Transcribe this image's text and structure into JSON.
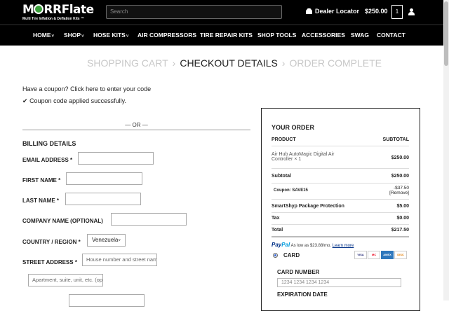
{
  "header": {
    "logo_text_pre": "M",
    "logo_text_post": "RRFlate",
    "logo_tagline": "Multi Tire Inflation & Deflation Kits ™",
    "search_placeholder": "Search",
    "dealer_locator": "Dealer Locator",
    "cart_total": "$250.00",
    "cart_count": "1"
  },
  "nav": {
    "items": [
      {
        "label": "HOME",
        "has_dropdown": true
      },
      {
        "label": "SHOP",
        "has_dropdown": true
      },
      {
        "label": "HOSE KITS",
        "has_dropdown": true
      },
      {
        "label": "AIR COMPRESSORS",
        "has_dropdown": false
      },
      {
        "label": "TIRE REPAIR KITS",
        "has_dropdown": false
      },
      {
        "label": "SHOP TOOLS",
        "has_dropdown": false
      },
      {
        "label": "ACCESSORIES",
        "has_dropdown": false
      },
      {
        "label": "SWAG",
        "has_dropdown": false
      },
      {
        "label": "CONTACT",
        "has_dropdown": false
      }
    ],
    "caret": "˅"
  },
  "steps": {
    "step1": "SHOPPING CART",
    "step2": "CHECKOUT DETAILS",
    "step3": "ORDER COMPLETE",
    "separator": "›"
  },
  "coupon": {
    "question": "Have a coupon?",
    "link": "Click here to enter your code",
    "success": "Coupon code applied successfully.",
    "check": "✔"
  },
  "or_text": "— OR —",
  "billing": {
    "heading": "BILLING DETAILS",
    "email_label": "EMAIL ADDRESS *",
    "first_label": "FIRST NAME *",
    "last_label": "LAST NAME *",
    "company_label": "COMPANY NAME (OPTIONAL)",
    "country_label": "COUNTRY / REGION *",
    "country_value": "Venezuela",
    "country_caret": "˅",
    "street_label": "STREET ADDRESS *",
    "street_placeholder": "House number and street name",
    "apt_placeholder": "Apartment, suite, unit, etc. (optional)"
  },
  "order": {
    "heading": "YOUR ORDER",
    "col_product": "PRODUCT",
    "col_subtotal": "SUBTOTAL",
    "item_name": "Air Hub AutoMagic Digital Air Controller",
    "item_qty": "× 1",
    "item_price": "$250.00",
    "subtotal_label": "Subtotal",
    "subtotal_value": "$250.00",
    "coupon_label": "Coupon: SAVE15",
    "coupon_value": "-$37.50",
    "coupon_remove": "[Remove]",
    "shipping_label": "SmartShyp Package Protection",
    "shipping_value": "$5.00",
    "tax_label": "Tax",
    "tax_value": "$0.00",
    "total_label": "Total",
    "total_value": "$217.50"
  },
  "payment": {
    "paypal_pay": "Pay",
    "paypal_pal": "Pal",
    "paypal_text": "As low as $23.88/mo.",
    "paypal_link": "Learn more",
    "card_label": "CARD",
    "card_brands": [
      "VISA",
      "MC",
      "AMEX",
      "DISC"
    ],
    "card_number_label": "CARD NUMBER",
    "card_number_placeholder": "1234 1234 1234 1234",
    "expiration_label": "EXPIRATION DATE"
  }
}
